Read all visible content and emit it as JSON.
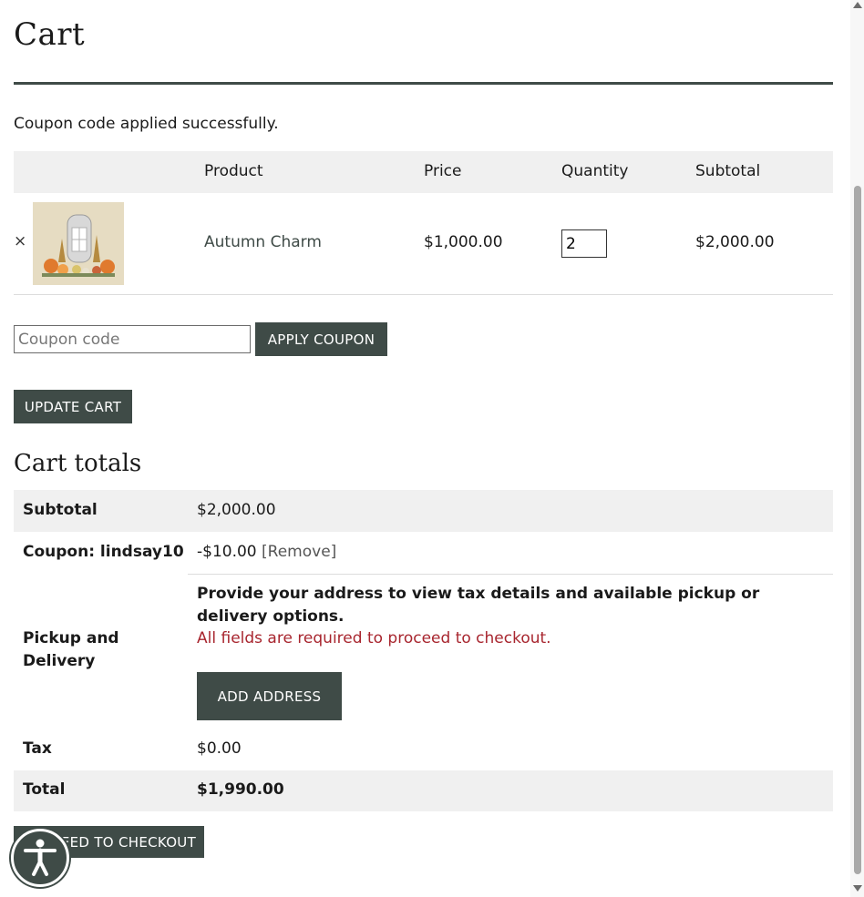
{
  "page": {
    "title": "Cart"
  },
  "notice": "Coupon code applied successfully.",
  "cart_table": {
    "headers": {
      "product": "Product",
      "price": "Price",
      "quantity": "Quantity",
      "subtotal": "Subtotal"
    },
    "items": [
      {
        "remove": "×",
        "product": "Autumn Charm",
        "price": "$1,000.00",
        "quantity": "2",
        "subtotal": "$2,000.00"
      }
    ]
  },
  "coupon": {
    "placeholder": "Coupon code",
    "apply_label": "APPLY COUPON"
  },
  "update_cart_label": "UPDATE CART",
  "totals": {
    "title": "Cart totals",
    "subtotal_label": "Subtotal",
    "subtotal_value": "$2,000.00",
    "coupon_label": "Coupon: lindsay10",
    "coupon_value": "-$10.00",
    "coupon_remove": "[Remove]",
    "delivery_label": "Pickup and Delivery",
    "delivery_text": "Provide your address to view tax details and available pickup or delivery options.",
    "delivery_required": "All fields are required to proceed to checkout.",
    "add_address_label": "ADD ADDRESS",
    "tax_label": "Tax",
    "tax_value": "$0.00",
    "total_label": "Total",
    "total_value": "$1,990.00"
  },
  "checkout_label": "PROCEED TO CHECKOUT",
  "colors": {
    "accent": "#3f4b47",
    "error": "#a8262f",
    "row_shade": "#f0f0f0"
  },
  "icons": {
    "accessibility": "accessibility-person-icon"
  }
}
